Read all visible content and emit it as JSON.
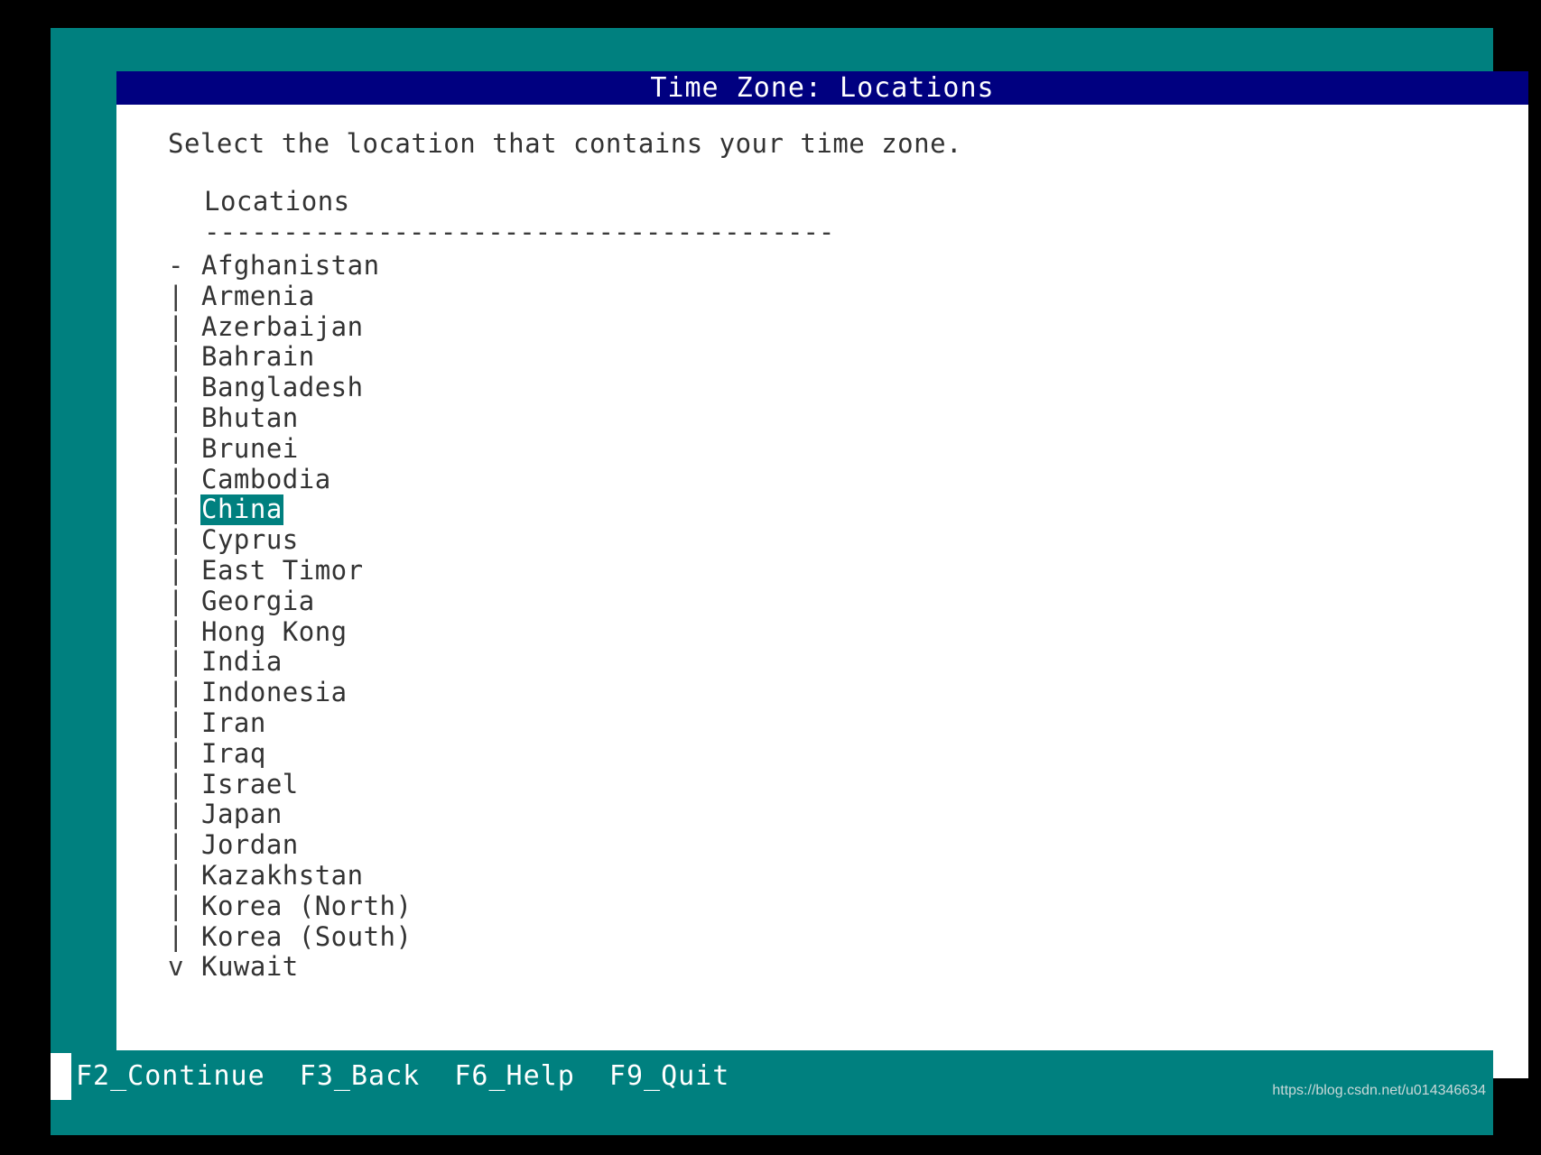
{
  "window": {
    "title": "Time Zone: Locations",
    "accent_teal": "#00807f",
    "title_bar_navy": "#000080",
    "content_bg": "#ffffff",
    "text_color": "#333333"
  },
  "content": {
    "instruction": "Select the location that contains your time zone.",
    "list_header": "Locations",
    "list_divider": "----------------------------------------"
  },
  "list": {
    "selected_value": "China",
    "scroll_up_marker": "-",
    "scroll_down_marker": "v",
    "body_marker": "|",
    "rows": [
      {
        "marker": "-",
        "label": "Afghanistan",
        "selected": false
      },
      {
        "marker": "|",
        "label": "Armenia",
        "selected": false
      },
      {
        "marker": "|",
        "label": "Azerbaijan",
        "selected": false
      },
      {
        "marker": "|",
        "label": "Bahrain",
        "selected": false
      },
      {
        "marker": "|",
        "label": "Bangladesh",
        "selected": false
      },
      {
        "marker": "|",
        "label": "Bhutan",
        "selected": false
      },
      {
        "marker": "|",
        "label": "Brunei",
        "selected": false
      },
      {
        "marker": "|",
        "label": "Cambodia",
        "selected": false
      },
      {
        "marker": "|",
        "label": "China",
        "selected": true
      },
      {
        "marker": "|",
        "label": "Cyprus",
        "selected": false
      },
      {
        "marker": "|",
        "label": "East Timor",
        "selected": false
      },
      {
        "marker": "|",
        "label": "Georgia",
        "selected": false
      },
      {
        "marker": "|",
        "label": "Hong Kong",
        "selected": false
      },
      {
        "marker": "|",
        "label": "India",
        "selected": false
      },
      {
        "marker": "|",
        "label": "Indonesia",
        "selected": false
      },
      {
        "marker": "|",
        "label": "Iran",
        "selected": false
      },
      {
        "marker": "|",
        "label": "Iraq",
        "selected": false
      },
      {
        "marker": "|",
        "label": "Israel",
        "selected": false
      },
      {
        "marker": "|",
        "label": "Japan",
        "selected": false
      },
      {
        "marker": "|",
        "label": "Jordan",
        "selected": false
      },
      {
        "marker": "|",
        "label": "Kazakhstan",
        "selected": false
      },
      {
        "marker": "|",
        "label": "Korea (North)",
        "selected": false
      },
      {
        "marker": "|",
        "label": "Korea (South)",
        "selected": false
      },
      {
        "marker": "v",
        "label": "Kuwait",
        "selected": false
      }
    ]
  },
  "function_bar": {
    "keys": [
      {
        "label": "F2_Continue"
      },
      {
        "label": "F3_Back"
      },
      {
        "label": "F6_Help"
      },
      {
        "label": "F9_Quit"
      }
    ],
    "joined": "F2_Continue  F3_Back  F6_Help  F9_Quit",
    "cursor_visible": true
  },
  "watermark": {
    "text": "https://blog.csdn.net/u014346634"
  }
}
